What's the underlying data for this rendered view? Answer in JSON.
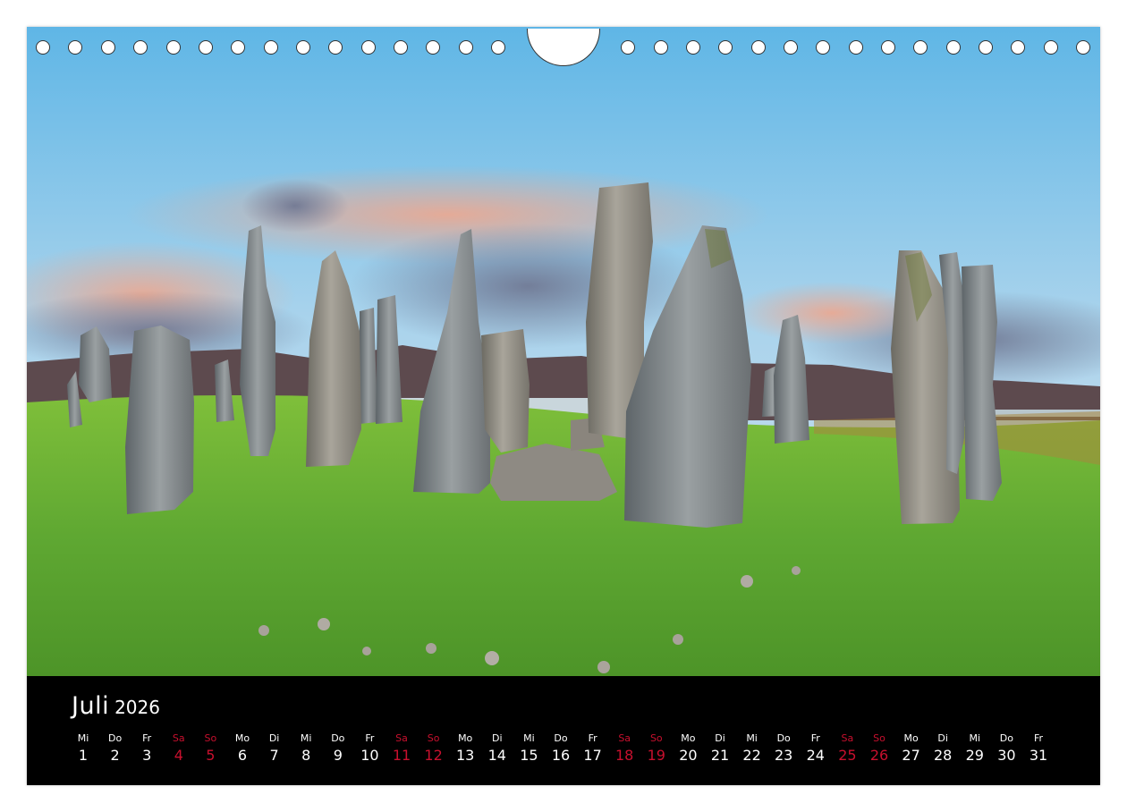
{
  "calendar": {
    "month": "Juli",
    "year": "2026",
    "days": [
      {
        "wd": "Mi",
        "d": "1",
        "we": false
      },
      {
        "wd": "Do",
        "d": "2",
        "we": false
      },
      {
        "wd": "Fr",
        "d": "3",
        "we": false
      },
      {
        "wd": "Sa",
        "d": "4",
        "we": true
      },
      {
        "wd": "So",
        "d": "5",
        "we": true
      },
      {
        "wd": "Mo",
        "d": "6",
        "we": false
      },
      {
        "wd": "Di",
        "d": "7",
        "we": false
      },
      {
        "wd": "Mi",
        "d": "8",
        "we": false
      },
      {
        "wd": "Do",
        "d": "9",
        "we": false
      },
      {
        "wd": "Fr",
        "d": "10",
        "we": false
      },
      {
        "wd": "Sa",
        "d": "11",
        "we": true
      },
      {
        "wd": "So",
        "d": "12",
        "we": true
      },
      {
        "wd": "Mo",
        "d": "13",
        "we": false
      },
      {
        "wd": "Di",
        "d": "14",
        "we": false
      },
      {
        "wd": "Mi",
        "d": "15",
        "we": false
      },
      {
        "wd": "Do",
        "d": "16",
        "we": false
      },
      {
        "wd": "Fr",
        "d": "17",
        "we": false
      },
      {
        "wd": "Sa",
        "d": "18",
        "we": true
      },
      {
        "wd": "So",
        "d": "19",
        "we": true
      },
      {
        "wd": "Mo",
        "d": "20",
        "we": false
      },
      {
        "wd": "Di",
        "d": "21",
        "we": false
      },
      {
        "wd": "Mi",
        "d": "22",
        "we": false
      },
      {
        "wd": "Do",
        "d": "23",
        "we": false
      },
      {
        "wd": "Fr",
        "d": "24",
        "we": false
      },
      {
        "wd": "Sa",
        "d": "25",
        "we": true
      },
      {
        "wd": "So",
        "d": "26",
        "we": true
      },
      {
        "wd": "Mo",
        "d": "27",
        "we": false
      },
      {
        "wd": "Di",
        "d": "28",
        "we": false
      },
      {
        "wd": "Mi",
        "d": "29",
        "we": false
      },
      {
        "wd": "Do",
        "d": "30",
        "we": false
      },
      {
        "wd": "Fr",
        "d": "31",
        "we": false
      }
    ]
  },
  "colors": {
    "weekend": "#c8102e",
    "weekday": "#ffffff",
    "calendar_background": "#000000"
  }
}
